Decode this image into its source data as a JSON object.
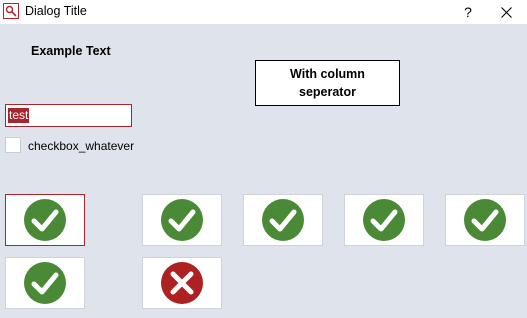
{
  "window": {
    "title": "Dialog Title",
    "help_label": "?",
    "app_icon": "search-icon",
    "close_icon": "close-icon"
  },
  "content": {
    "example_text": "Example Text",
    "column_separator_box": "With column seperator",
    "text_input": {
      "value": "test"
    },
    "checkbox": {
      "label": "checkbox_whatever",
      "checked": false
    }
  },
  "tiles": [
    {
      "status": "success",
      "icon": "checkmark-icon",
      "focused": true
    },
    {
      "status": "success",
      "icon": "checkmark-icon",
      "focused": false
    },
    {
      "status": "success",
      "icon": "checkmark-icon",
      "focused": false
    },
    {
      "status": "success",
      "icon": "checkmark-icon",
      "focused": false
    },
    {
      "status": "success",
      "icon": "checkmark-icon",
      "focused": false
    },
    {
      "status": "success",
      "icon": "checkmark-icon",
      "focused": false
    },
    {
      "status": "error",
      "icon": "cross-icon",
      "focused": false
    }
  ],
  "colors": {
    "success": "#4a8a37",
    "error": "#ad2123",
    "accent": "#a7252d",
    "background": "#dfe3ec"
  }
}
